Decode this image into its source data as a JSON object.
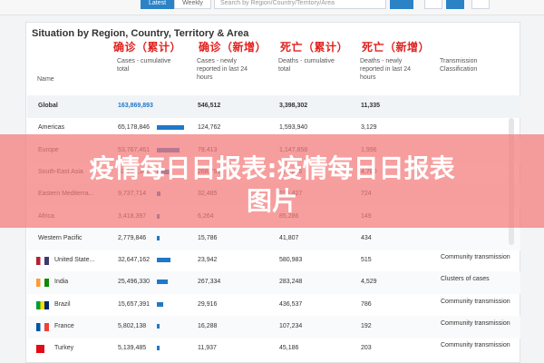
{
  "top": {
    "tabs": [
      "Latest",
      "Weekly"
    ],
    "search_placeholder": "Search by Region/Country/Territory/Area"
  },
  "panel": {
    "title": "Situation by Region, Country, Territory & Area",
    "cn_labels": [
      "确诊（累计）",
      "确诊（新增）",
      "死亡（累计）",
      "死亡（新增）"
    ],
    "headers": {
      "name": "Name",
      "cases_total": "Cases - cumulative total",
      "cases_new": "Cases - newly reported in last 24 hours",
      "deaths_total": "Deaths - cumulative total",
      "deaths_new": "Deaths - newly reported in last 24 hours",
      "transmission": "Transmission Classification"
    },
    "rows": [
      {
        "name": "Global",
        "cases": "163,869,893",
        "new": "546,512",
        "deaths": "3,398,302",
        "dnew": "11,335",
        "trans": ""
      },
      {
        "name": "Americas",
        "cases": "65,178,846",
        "new": "124,762",
        "deaths": "1,593,940",
        "dnew": "3,129",
        "trans": ""
      },
      {
        "name": "Europe",
        "cases": "53,767,461",
        "new": "78,413",
        "deaths": "1,147,858",
        "dnew": "1,996",
        "trans": ""
      },
      {
        "name": "South-East Asia",
        "cases": "32,166,345",
        "new": "268,791",
        "deaths": "375,026",
        "dnew": "4,780",
        "trans": ""
      },
      {
        "name": "Eastern Mediterra...",
        "cases": "9,737,714",
        "new": "32,485",
        "deaths": "195,427",
        "dnew": "724",
        "trans": ""
      },
      {
        "name": "Africa",
        "cases": "3,418,397",
        "new": "6,264",
        "deaths": "85,286",
        "dnew": "149",
        "trans": ""
      },
      {
        "name": "Western Pacific",
        "cases": "2,779,846",
        "new": "15,786",
        "deaths": "41,807",
        "dnew": "434",
        "trans": ""
      },
      {
        "name": "United State...",
        "cases": "32,647,162",
        "new": "23,942",
        "deaths": "580,983",
        "dnew": "515",
        "trans": "Community transmission"
      },
      {
        "name": "India",
        "cases": "25,496,330",
        "new": "267,334",
        "deaths": "283,248",
        "dnew": "4,529",
        "trans": "Clusters of cases"
      },
      {
        "name": "Brazil",
        "cases": "15,657,391",
        "new": "29,916",
        "deaths": "436,537",
        "dnew": "786",
        "trans": "Community transmission"
      },
      {
        "name": "France",
        "cases": "5,802,138",
        "new": "16,288",
        "deaths": "107,234",
        "dnew": "192",
        "trans": "Community transmission"
      },
      {
        "name": "Turkey",
        "cases": "5,139,485",
        "new": "11,937",
        "deaths": "45,186",
        "dnew": "203",
        "trans": "Community transmission"
      }
    ]
  },
  "watermark": {
    "line1": "疫情每日日报表:疫情每日日报表",
    "line2": "图片"
  },
  "colors": {
    "accent": "#2b83c6",
    "bar": "#1f78c8",
    "cn_red": "#e0211d",
    "watermark": "#f47878"
  }
}
